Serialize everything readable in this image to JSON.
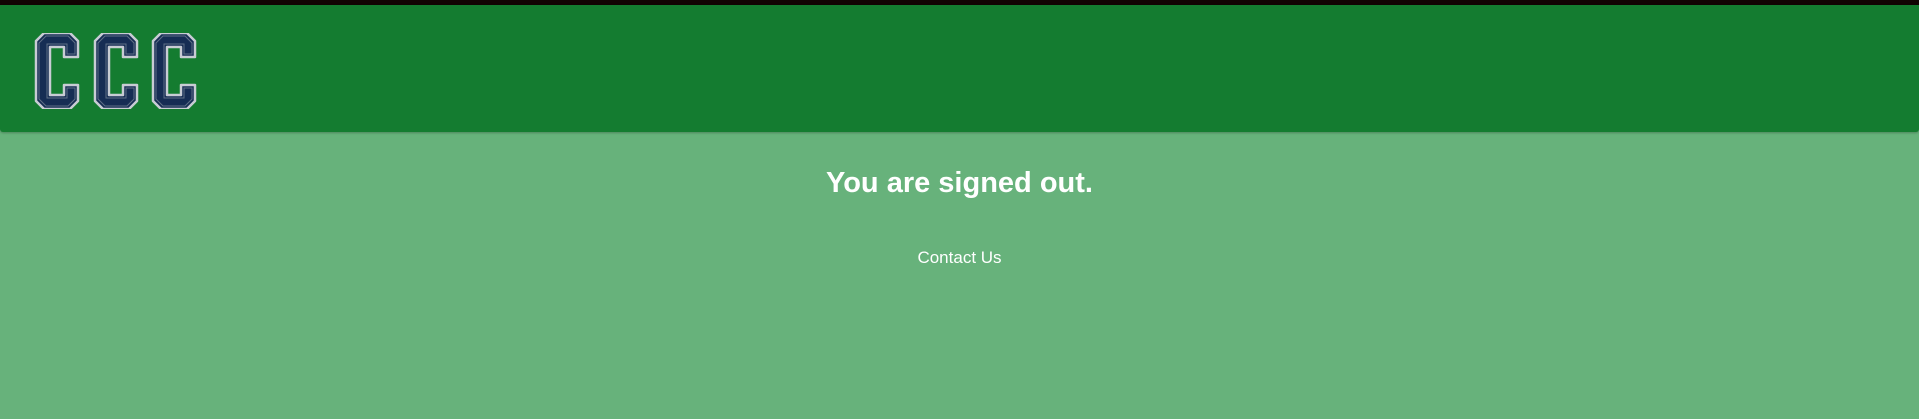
{
  "header": {
    "logo_text": "CCC",
    "colors": {
      "header_bg": "#147c30",
      "top_strip": "#120303",
      "logo_fill": "#162d54",
      "logo_outline": "#c8ccd4"
    }
  },
  "main": {
    "title": "You are signed out.",
    "contact_link": "Contact Us",
    "colors": {
      "background": "#67b27b",
      "text": "#ffffff"
    }
  }
}
